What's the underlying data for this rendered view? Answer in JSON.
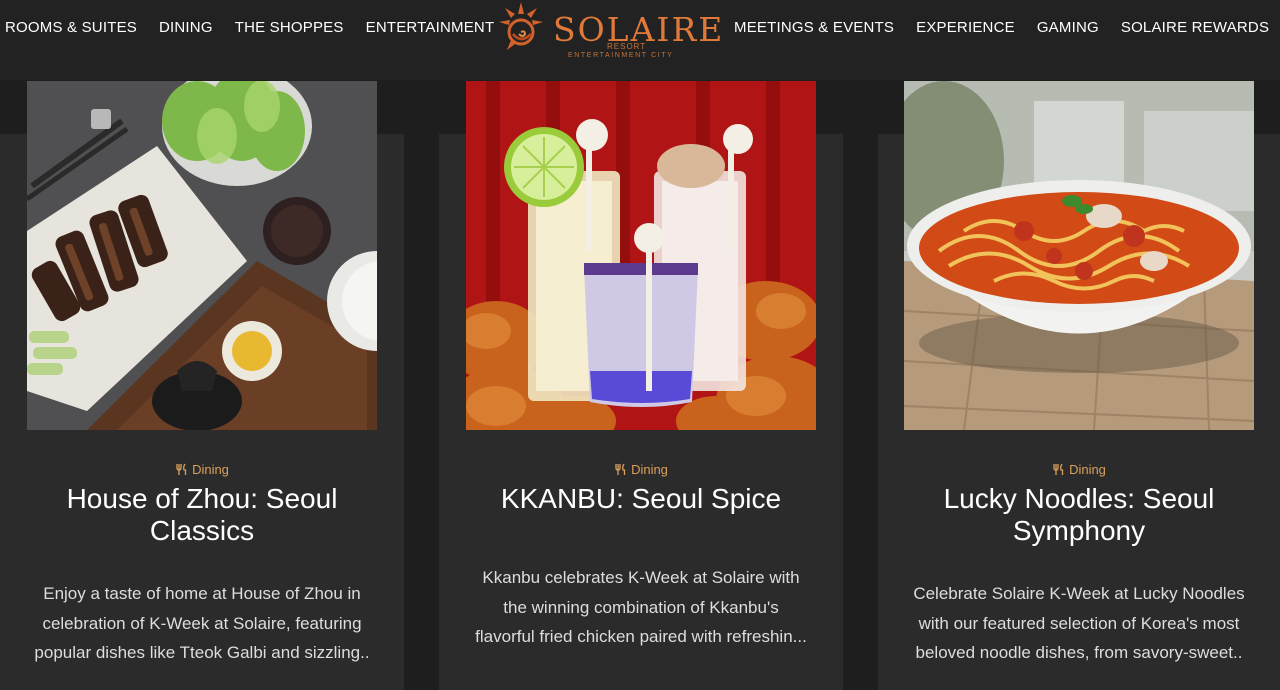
{
  "nav": {
    "left": [
      "ROOMS & SUITES",
      "DINING",
      "THE SHOPPES",
      "ENTERTAINMENT"
    ],
    "right": [
      "MEETINGS & EVENTS",
      "EXPERIENCE",
      "GAMING",
      "SOLAIRE REWARDS"
    ]
  },
  "logo": {
    "word": "SOLAIRE",
    "sub1": "RESORT",
    "sub2": "ENTERTAINMENT CITY"
  },
  "cards": [
    {
      "category": "Dining",
      "title_lines": [
        "House of Zhou: Seoul",
        "Classics"
      ],
      "desc_lines": [
        "Enjoy a taste of home at House of Zhou in",
        "celebration of K-Week at Solaire, featuring",
        "popular dishes like Tteok Galbi and sizzling.."
      ]
    },
    {
      "category": "Dining",
      "title_lines": [
        "KKANBU: Seoul Spice"
      ],
      "desc_lines": [
        "Kkanbu celebrates K-Week at Solaire with",
        "the winning combination of Kkanbu's",
        "flavorful fried chicken paired with refreshin..."
      ]
    },
    {
      "category": "Dining",
      "title_lines": [
        "Lucky Noodles: Seoul",
        "Symphony"
      ],
      "desc_lines": [
        "Celebrate Solaire K-Week at Lucky Noodles",
        "with our featured selection of Korea's most",
        "beloved noodle dishes, from savory-sweet.."
      ]
    }
  ],
  "icons": {
    "category": "fork-knife-icon"
  },
  "colors": {
    "page_bg": "#1e1e1e",
    "card_bg": "#2b2b2b",
    "accent": "#d9a05b",
    "logo": "#e07a3a"
  }
}
